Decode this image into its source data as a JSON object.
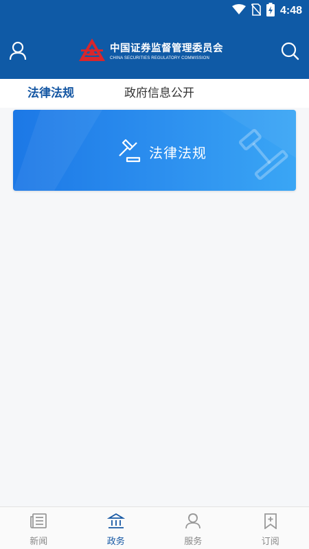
{
  "status": {
    "time": "4:48"
  },
  "header": {
    "logo_cn": "中国证券监督管理委员会",
    "logo_en": "CHINA SECURITIES REGULATORY COMMISSION"
  },
  "tabs": [
    {
      "label": "法律法规",
      "active": true
    },
    {
      "label": "政府信息公开",
      "active": false
    }
  ],
  "banner": {
    "title": "法律法规"
  },
  "bottom_nav": [
    {
      "label": "新闻",
      "icon": "newspaper-icon"
    },
    {
      "label": "政务",
      "icon": "government-icon",
      "active": true
    },
    {
      "label": "服务",
      "icon": "service-icon"
    },
    {
      "label": "订阅",
      "icon": "subscribe-icon"
    }
  ],
  "colors": {
    "primary": "#0f5aa6",
    "active": "#1557a3",
    "banner": "#2d90ef"
  }
}
